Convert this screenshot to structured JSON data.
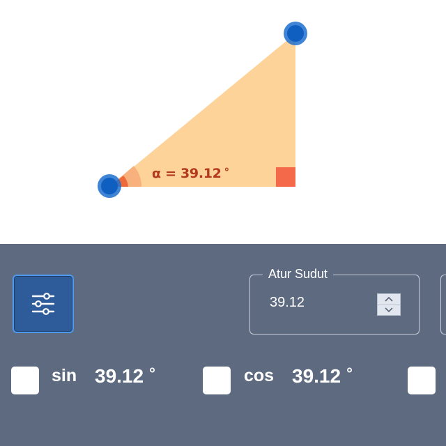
{
  "canvas": {
    "angle_label": "α = 39.12",
    "angle_unit": "°",
    "colors": {
      "triangle_fill": "#fdd39a",
      "angle_marker": "#ee6a3a",
      "right_angle_marker": "#f4694a",
      "vertex_handle": "#1e6fcf"
    }
  },
  "controls": {
    "settings_icon": "sliders-icon",
    "angle_field": {
      "legend": "Atur Sudut",
      "value": "39.12"
    },
    "functions": [
      {
        "label": "sin",
        "value": "39.12",
        "unit": "°",
        "checked": false
      },
      {
        "label": "cos",
        "value": "39.12",
        "unit": "°",
        "checked": false
      },
      {
        "label": "",
        "value": "",
        "unit": "",
        "checked": false
      }
    ]
  },
  "colors": {
    "panel_bg": "#5e6a80",
    "accent_button": "#2e5c9a",
    "accent_border": "#4d9af0"
  }
}
